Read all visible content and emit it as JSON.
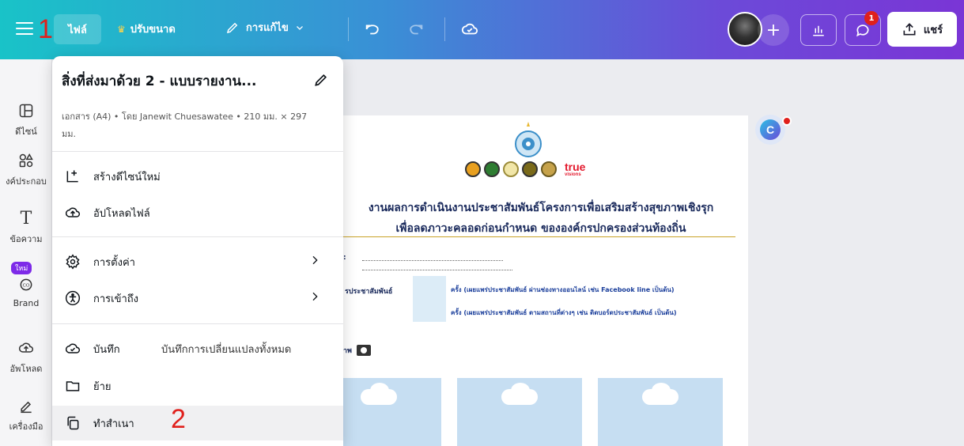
{
  "topbar": {
    "file_label": "ไฟล์",
    "resize_label": "ปรับขนาด",
    "edit_label": "การแก้ไข",
    "share_label": "แชร์",
    "comment_badge": "1"
  },
  "annotations": {
    "step1": "1",
    "step2": "2"
  },
  "sidebar": {
    "items": [
      {
        "label": "ดีไซน์",
        "icon": "design-icon"
      },
      {
        "label": "งค์ประกอบ",
        "icon": "elements-icon"
      },
      {
        "label": "ข้อความ",
        "icon": "text-icon"
      },
      {
        "label": "Brand",
        "icon": "brand-icon",
        "badge": "ใหม่"
      },
      {
        "label": "อัพโหลด",
        "icon": "upload-icon"
      },
      {
        "label": "เครื่องมือ",
        "icon": "tools-icon"
      }
    ]
  },
  "menu": {
    "title": "สิ่งที่ส่งมาด้วย 2 - แบบรายงาน...",
    "subtitle": "เอกสาร (A4) • โดย Janewit Chuesawatee • 210 มม. × 297 มม.",
    "items": [
      {
        "label": "สร้างดีไซน์ใหม่",
        "icon": "create-design-icon"
      },
      {
        "label": "อัปโหลดไฟล์",
        "icon": "upload-cloud-icon"
      },
      {
        "label": "การตั้งค่า",
        "icon": "settings-icon"
      },
      {
        "label": "การเข้าถึง",
        "icon": "accessibility-icon"
      },
      {
        "label": "บันทึก",
        "icon": "save-cloud-icon",
        "extra": "บันทึกการเปลี่ยนแปลงทั้งหมด"
      },
      {
        "label": "ย้าย",
        "icon": "folder-icon"
      },
      {
        "label": "ทำสำเนา",
        "icon": "copy-icon"
      }
    ]
  },
  "document": {
    "title_line1": "งานผลการดำเนินงานประชาสัมพันธ์โครงการเพื่อเสริมสร้างสุขภาพเชิงรุก",
    "title_line2": "เพื่อลดภาวะคลอดก่อนกำหนด ขององค์กรปกครองส่วนท้องถิ่น",
    "pr_label": "รประชาสัมพันธ์",
    "note1": "ครั้ง (เผยแพร่ประชาสัมพันธ์ ผ่านช่องทางออนไลน์ เช่น Facebook line เป็นต้น)",
    "note2": "ครั้ง (เผยแพร่ประชาสัมพันธ์ ตามสถานที่ต่างๆ เช่น ติดบอร์ดประชาสัมพันธ์ เป็นต้น)",
    "photo_label": "าพ",
    "true_logo": "true",
    "true_sub": "visions"
  },
  "colors": {
    "accent_purple": "#7d2ae8",
    "topbar_start": "#19c3c8",
    "topbar_end": "#7a35d6",
    "annotation_red": "#e0201c"
  }
}
